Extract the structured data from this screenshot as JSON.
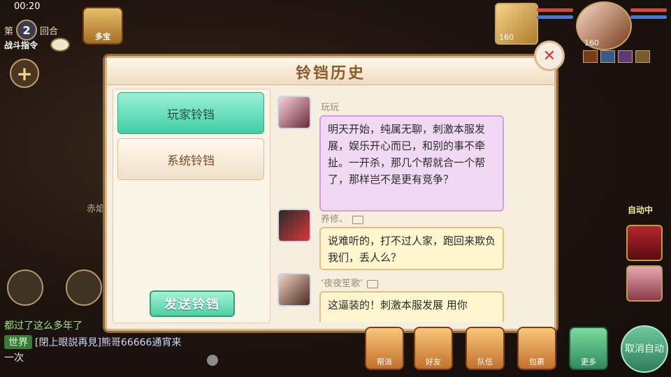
{
  "status_bar": {
    "time": "00:20"
  },
  "hud": {
    "round_prefix": "第",
    "round_number": "2",
    "round_suffix": "回合",
    "battle_command": "战斗指令",
    "treasure_label": "多宝",
    "side_text": "赤焰"
  },
  "portraits": {
    "pet_level": "160",
    "hero_level": "160"
  },
  "dialog": {
    "title": "铃铛历史",
    "tabs": [
      {
        "label": "玩家铃铛",
        "active": true
      },
      {
        "label": "系统铃铛",
        "active": false
      }
    ],
    "send_button": "发送铃铛",
    "messages": [
      {
        "sender": "玩玩",
        "text": "明天开始，纯属无聊，刺激本服发展，娱乐开心而已，和别的事不牵扯。一开杀，那几个帮就合一个帮了，那样岂不是更有竞争？",
        "style": "pink"
      },
      {
        "sender": "养修、",
        "text": "说难听的，打不过人家，跑回来欺负我们，丢人么？",
        "style": "yellow"
      },
      {
        "sender": "‘夜夜笙歌’",
        "text": "这逼装的！刺激本服发展 用你",
        "style": "yellow"
      }
    ]
  },
  "chat": {
    "line1": "都过了这么多年了",
    "channel": "世界",
    "line2": "[閉上眼説再見]熊哥66666通宵来",
    "line3": "一次"
  },
  "bottom_menu": [
    "帮派",
    "好友",
    "队伍",
    "包裹",
    "更多"
  ],
  "auto_status": "自动中",
  "cancel_auto": "取消自动",
  "colors": {
    "accent_green": "#3fcfa6",
    "dialog_bg": "#f6efdf",
    "title_brown": "#8d5a2a"
  }
}
